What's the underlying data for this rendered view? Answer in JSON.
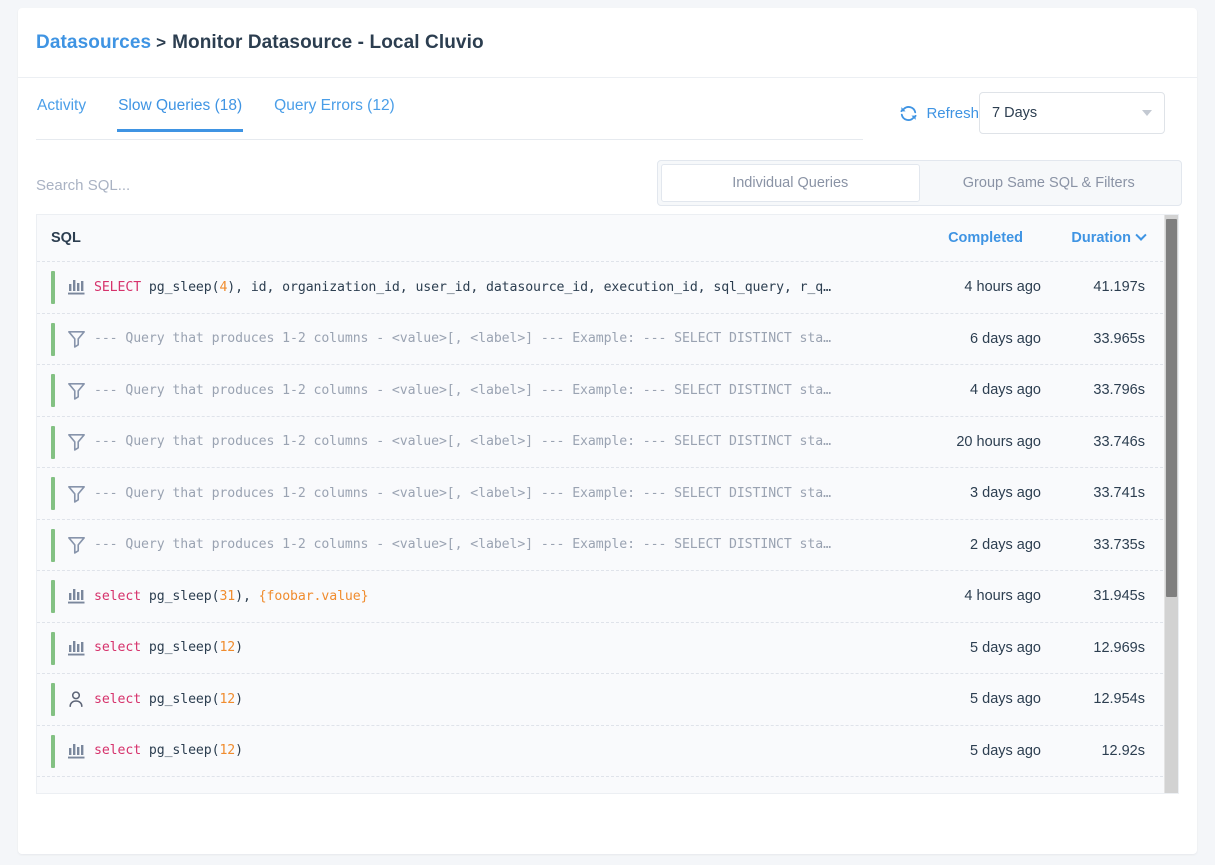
{
  "breadcrumb": {
    "root": "Datasources",
    "separator": ">",
    "current": "Monitor Datasource - Local Cluvio"
  },
  "tabs": [
    {
      "label": "Activity",
      "active": false,
      "name": "tab-activity"
    },
    {
      "label": "Slow Queries (18)",
      "active": true,
      "name": "tab-slow-queries"
    },
    {
      "label": "Query Errors (12)",
      "active": false,
      "name": "tab-query-errors"
    }
  ],
  "toolbar": {
    "refresh_label": "Refresh",
    "refresh_icon": "refresh-icon",
    "range_value": "7 Days",
    "range_caret_icon": "caret-down-icon"
  },
  "search": {
    "value": "",
    "placeholder": "Search SQL..."
  },
  "segmented": [
    {
      "label": "Individual Queries",
      "selected": true,
      "name": "segment-individual-queries"
    },
    {
      "label": "Group Same SQL & Filters",
      "selected": false,
      "name": "segment-group-same-sql"
    }
  ],
  "table": {
    "columns": {
      "sql": "SQL",
      "completed": "Completed",
      "duration": "Duration"
    },
    "sort": {
      "column": "Duration",
      "direction": "desc",
      "icon": "chevron-down-icon"
    },
    "rows": [
      {
        "icon": "bar-chart-icon",
        "sql_plain": "SELECT pg_sleep(4), id, organization_id, user_id, datasource_id, execution_id, sql_query, r_q…",
        "sql_html": "<span class=\"kw\">SELECT</span> <span class=\"pl\">pg_sleep(</span><span class=\"num\">4</span><span class=\"pl\">), id, organization_id, user_id, datasource_id, execution_id, sql_query, r_q…</span>",
        "completed": "4 hours ago",
        "duration": "41.197s"
      },
      {
        "icon": "filter-icon",
        "sql_plain": "--- Query that produces 1-2 columns - <value>[, <label>] --- Example: --- SELECT DISTINCT sta…",
        "sql_html": "<span class=\"cmt\">--- Query that produces 1-2 columns - &lt;value&gt;[, &lt;label&gt;] --- Example: --- SELECT DISTINCT sta…</span>",
        "completed": "6 days ago",
        "duration": "33.965s"
      },
      {
        "icon": "filter-icon",
        "sql_plain": "--- Query that produces 1-2 columns - <value>[, <label>] --- Example: --- SELECT DISTINCT sta…",
        "sql_html": "<span class=\"cmt\">--- Query that produces 1-2 columns - &lt;value&gt;[, &lt;label&gt;] --- Example: --- SELECT DISTINCT sta…</span>",
        "completed": "4 days ago",
        "duration": "33.796s"
      },
      {
        "icon": "filter-icon",
        "sql_plain": "--- Query that produces 1-2 columns - <value>[, <label>] --- Example: --- SELECT DISTINCT sta…",
        "sql_html": "<span class=\"cmt\">--- Query that produces 1-2 columns - &lt;value&gt;[, &lt;label&gt;] --- Example: --- SELECT DISTINCT sta…</span>",
        "completed": "20 hours ago",
        "duration": "33.746s"
      },
      {
        "icon": "filter-icon",
        "sql_plain": "--- Query that produces 1-2 columns - <value>[, <label>] --- Example: --- SELECT DISTINCT sta…",
        "sql_html": "<span class=\"cmt\">--- Query that produces 1-2 columns - &lt;value&gt;[, &lt;label&gt;] --- Example: --- SELECT DISTINCT sta…</span>",
        "completed": "3 days ago",
        "duration": "33.741s"
      },
      {
        "icon": "filter-icon",
        "sql_plain": "--- Query that produces 1-2 columns - <value>[, <label>] --- Example: --- SELECT DISTINCT sta…",
        "sql_html": "<span class=\"cmt\">--- Query that produces 1-2 columns - &lt;value&gt;[, &lt;label&gt;] --- Example: --- SELECT DISTINCT sta…</span>",
        "completed": "2 days ago",
        "duration": "33.735s"
      },
      {
        "icon": "bar-chart-icon",
        "sql_plain": "select pg_sleep(31), {foobar.value}",
        "sql_html": "<span class=\"kw\">select</span> <span class=\"pl\">pg_sleep(</span><span class=\"num\">31</span><span class=\"pl\">), </span><span class=\"var\">{foobar.value}</span>",
        "completed": "4 hours ago",
        "duration": "31.945s"
      },
      {
        "icon": "bar-chart-icon",
        "sql_plain": "select pg_sleep(12)",
        "sql_html": "<span class=\"kw\">select</span> <span class=\"pl\">pg_sleep(</span><span class=\"num\">12</span><span class=\"pl\">)</span>",
        "completed": "5 days ago",
        "duration": "12.969s"
      },
      {
        "icon": "user-icon",
        "sql_plain": "select pg_sleep(12)",
        "sql_html": "<span class=\"kw\">select</span> <span class=\"pl\">pg_sleep(</span><span class=\"num\">12</span><span class=\"pl\">)</span>",
        "completed": "5 days ago",
        "duration": "12.954s"
      },
      {
        "icon": "bar-chart-icon",
        "sql_plain": "select pg_sleep(12)",
        "sql_html": "<span class=\"kw\">select</span> <span class=\"pl\">pg_sleep(</span><span class=\"num\">12</span><span class=\"pl\">)</span>",
        "completed": "5 days ago",
        "duration": "12.92s"
      }
    ]
  },
  "colors": {
    "accent_blue": "#3f94e3",
    "row_marker_green": "#83c183",
    "keyword_pink": "#d6336c",
    "number_orange": "#f08c2e",
    "comment_gray": "#9aa3b2",
    "page_bg": "#f4f6f9"
  }
}
